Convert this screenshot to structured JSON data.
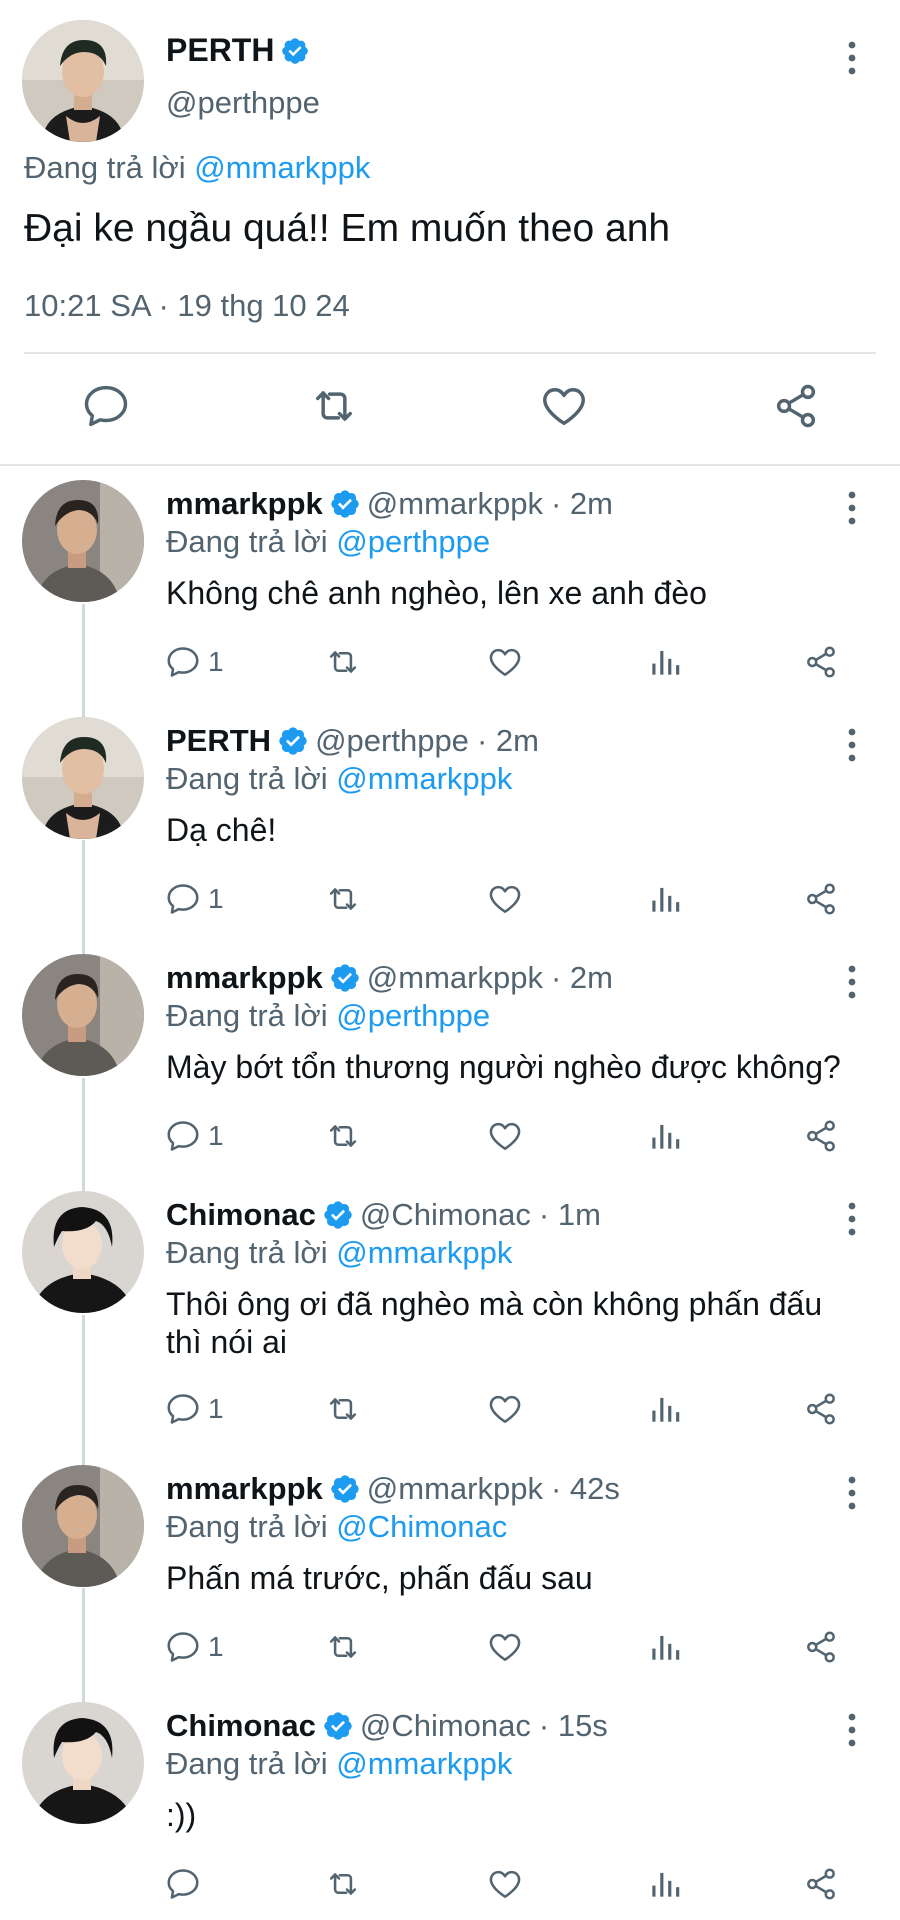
{
  "main_tweet": {
    "name": "PERTH",
    "handle": "@perthppe",
    "replying_prefix": "Đang trả lời",
    "replying_to": "@mmarkppk",
    "text": "Đại ke ngầu quá!! Em muốn theo anh",
    "timestamp": "10:21 SA · 19 thg 10 24",
    "icons": [
      "reply-icon",
      "retweet-icon",
      "like-icon",
      "share-icon"
    ]
  },
  "replies": [
    {
      "name": "mmarkppk",
      "handle": "@mmarkppk",
      "time": "· 2m",
      "replying_prefix": "Đang trả lời",
      "replying_to": "@perthppe",
      "text": "Không chê anh nghèo, lên xe anh đèo",
      "reply_count": "1"
    },
    {
      "name": "PERTH",
      "handle": "@perthppe",
      "time": "· 2m",
      "replying_prefix": "Đang trả lời",
      "replying_to": "@mmarkppk",
      "text": "Dạ chê!",
      "reply_count": "1"
    },
    {
      "name": "mmarkppk",
      "handle": "@mmarkppk",
      "time": "· 2m",
      "replying_prefix": "Đang trả lời",
      "replying_to": "@perthppe",
      "text": "Mày bớt tổn thương người nghèo được không?",
      "reply_count": "1"
    },
    {
      "name": "Chimonac",
      "handle": "@Chimonac",
      "time": "· 1m",
      "replying_prefix": "Đang trả lời",
      "replying_to": "@mmarkppk",
      "text": "Thôi ông ơi đã nghèo mà còn không phấn đấu thì nói ai",
      "reply_count": "1"
    },
    {
      "name": "mmarkppk",
      "handle": "@mmarkppk",
      "time": "· 42s",
      "replying_prefix": "Đang trả lời",
      "replying_to": "@Chimonac",
      "text": "Phấn má trước, phấn đấu sau",
      "reply_count": "1"
    },
    {
      "name": "Chimonac",
      "handle": "@Chimonac",
      "time": "· 15s",
      "replying_prefix": "Đang trả lời",
      "replying_to": "@mmarkppk",
      "text": ":))",
      "reply_count": ""
    }
  ],
  "colors": {
    "accent": "#1d9bf0",
    "verified": "#1d9bf0",
    "secondary_text": "#536471",
    "divider": "#e3e6e8"
  }
}
